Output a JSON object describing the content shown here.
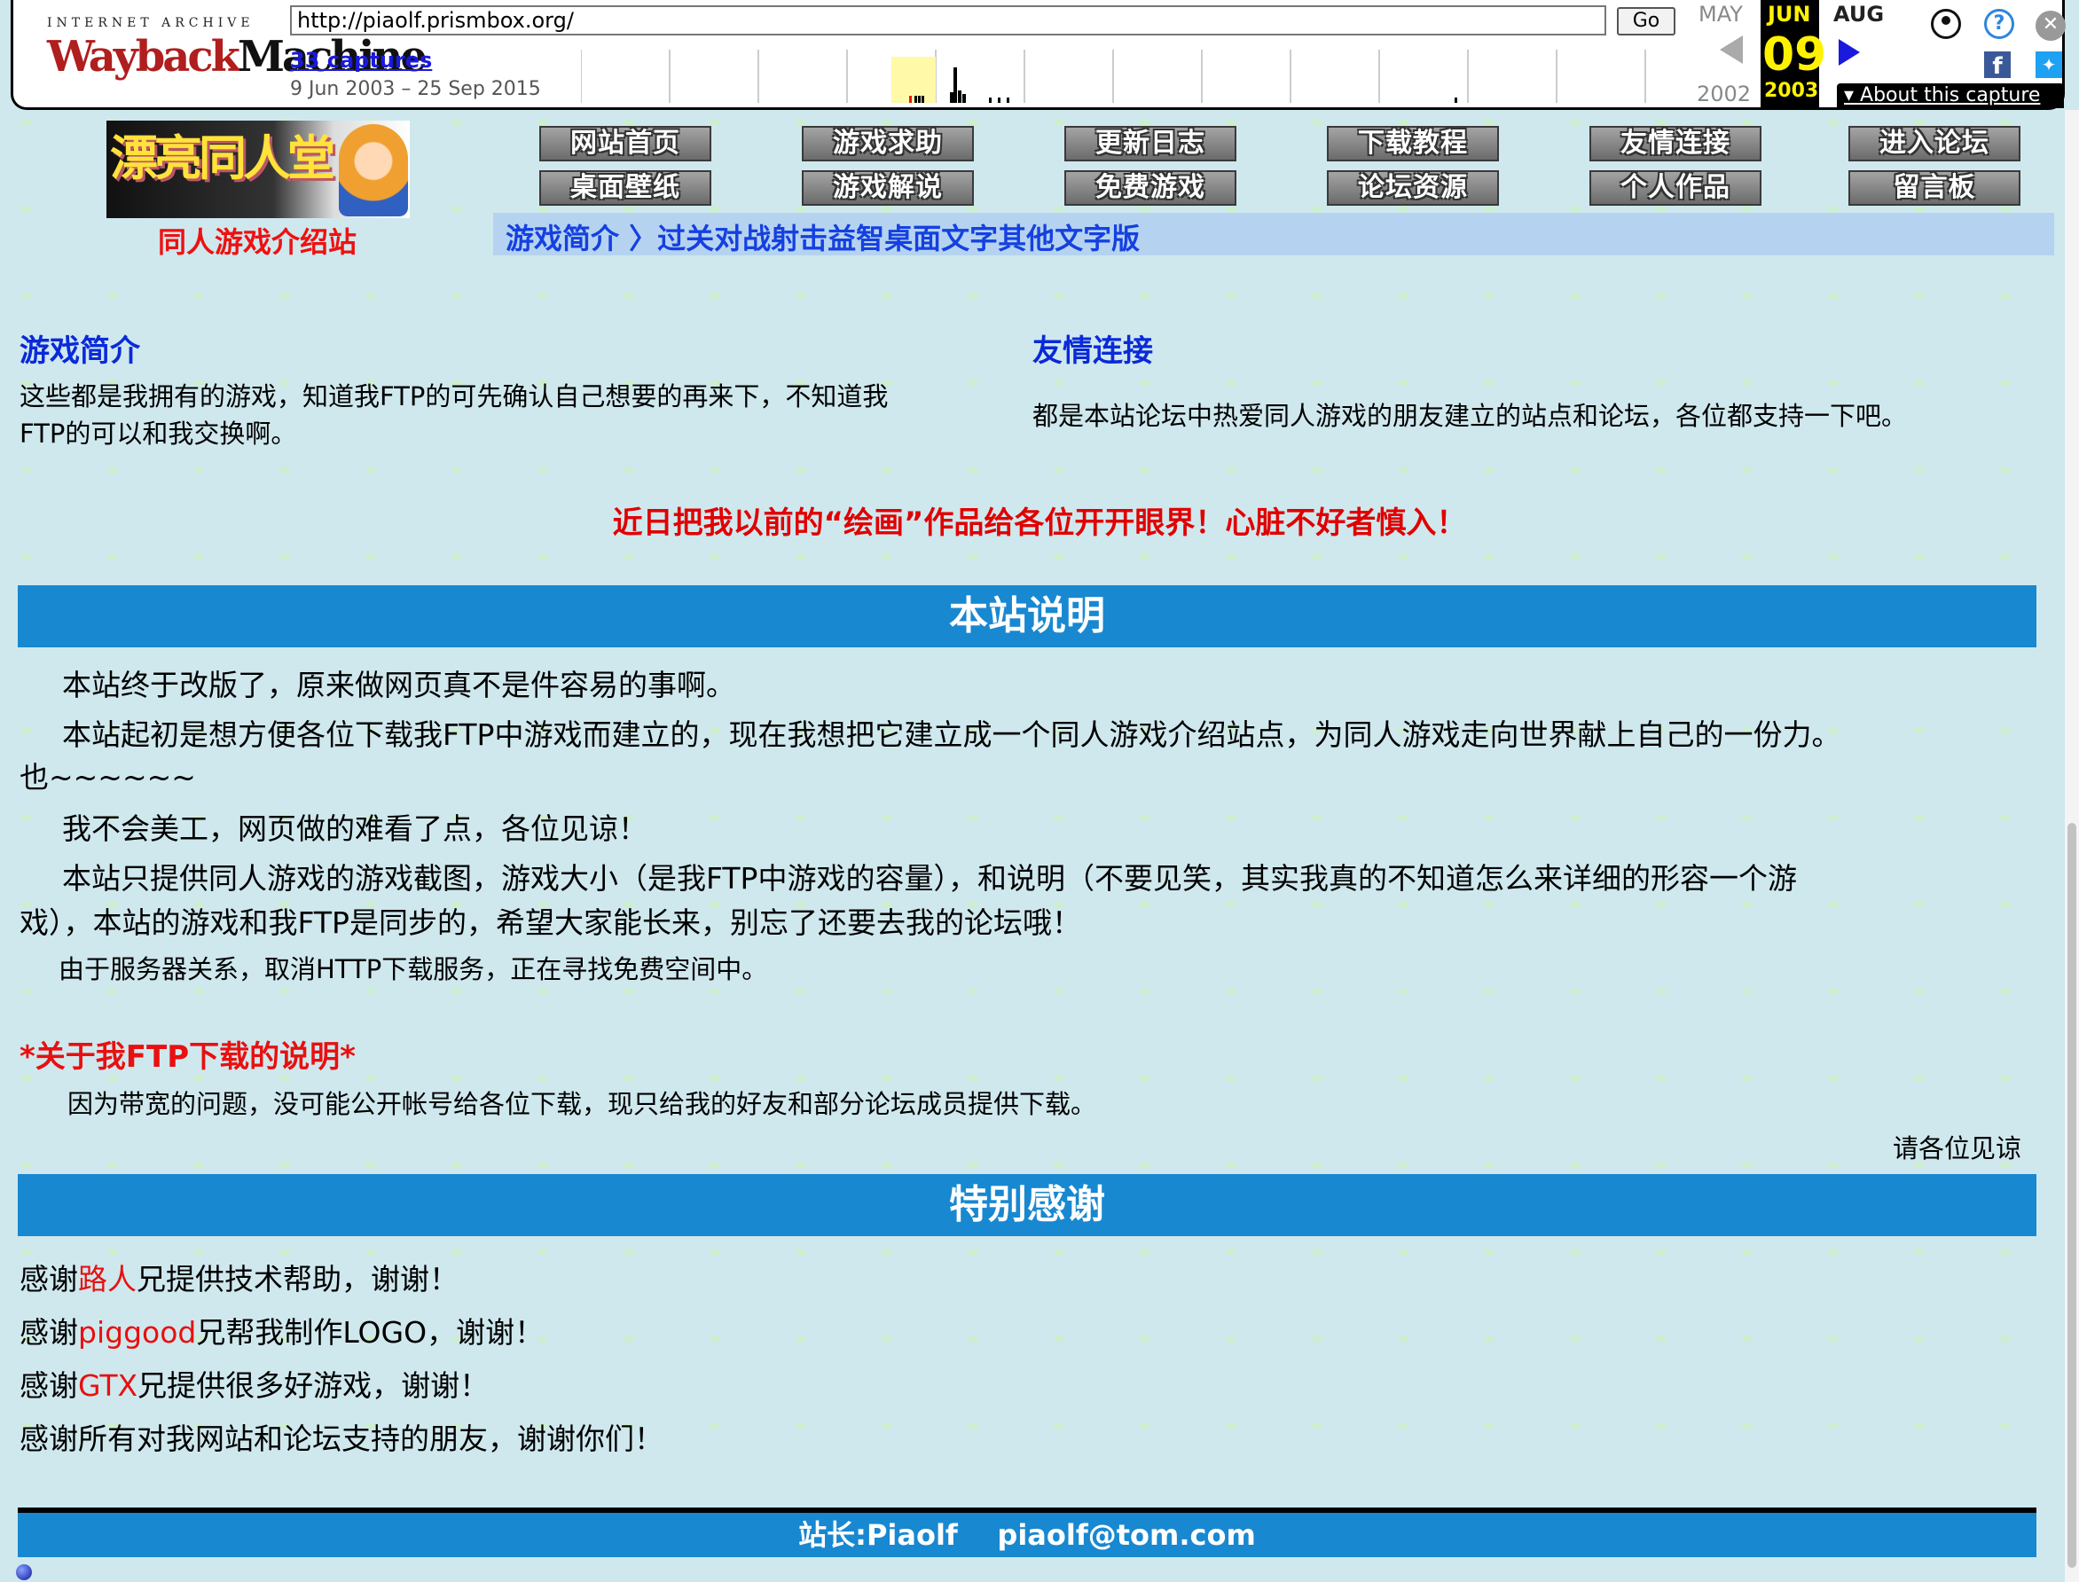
{
  "wayback": {
    "logo_top": "INTERNET ARCHIVE",
    "logo_main_red": "Wayback",
    "logo_main_black": "Machine",
    "url": "http://piaolf.prismbox.org/",
    "go_label": "Go",
    "captures": "33 captures",
    "date_range": "9 Jun 2003 – 25 Sep 2015",
    "prev_month": "MAY",
    "current_month": "JUN",
    "next_month": "AUG",
    "day": "09",
    "prev_year": "2002",
    "current_year": "2003",
    "about": "About this capture",
    "icons": [
      "user-icon",
      "help-icon",
      "close-icon",
      "facebook-icon",
      "twitter-icon"
    ],
    "accent_color": "#fff200"
  },
  "site": {
    "logo_text": "漂亮同人堂",
    "subtitle": "同人游戏介绍站",
    "nav": [
      [
        "网站首页",
        "桌面壁纸"
      ],
      [
        "游戏求助",
        "游戏解说"
      ],
      [
        "更新日志",
        "免费游戏"
      ],
      [
        "下载教程",
        "论坛资源"
      ],
      [
        "友情连接",
        "个人作品"
      ],
      [
        "进入论坛",
        "留言板"
      ]
    ],
    "category_bar": "游戏简介 〉过关对战射击益智桌面文字其他文字版"
  },
  "intro": {
    "games_title": "游戏简介",
    "games_text_1": "这些都是我拥有的游戏，知道我FTP的可先确认自己想要的再来下，不知道我",
    "games_text_2": "FTP的可以和我交换啊。",
    "links_title": "友情连接",
    "links_text": "都是本站论坛中热爱同人游戏的朋友建立的站点和论坛，各位都支持一下吧。"
  },
  "promo": "近日把我以前的“绘画”作品给各位开开眼界！心脏不好者慎入！",
  "about": {
    "title": "本站说明",
    "p1": "本站终于改版了，原来做网页真不是件容易的事啊。",
    "p2a": "本站起初是想方便各位下载我FTP中游戏而建立的，现在我想把它建立成一个同人游戏介绍站点，为同人游戏走向世界献上自己的一份力。",
    "p2b": "也~~~~~~",
    "p3": "我不会美工，网页做的难看了点，各位见谅！",
    "p4a": "本站只提供同人游戏的游戏截图，游戏大小（是我FTP中游戏的容量），和说明（不要见笑，其实我真的不知道怎么来详细的形容一个游",
    "p4b": "戏），本站的游戏和我FTP是同步的，希望大家能长来，别忘了还要去我的论坛哦！",
    "p5": "由于服务器关系，取消HTTP下载服务，正在寻找免费空间中。",
    "ftp_title": "*关于我FTP下载的说明*",
    "ftp_text": "因为带宽的问题，没可能公开帐号给各位下载，现只给我的好友和部分论坛成员提供下载。",
    "ftp_sign": "请各位见谅"
  },
  "thanks": {
    "title": "特别感谢",
    "lines": [
      {
        "pre": "感谢",
        "name": "路人",
        "post": "兄提供技术帮助，谢谢！"
      },
      {
        "pre": "感谢",
        "name": "piggood",
        "post": "兄帮我制作LOGO，谢谢！"
      },
      {
        "pre": "感谢",
        "name": "GTX",
        "post": "兄提供很多好游戏，谢谢！"
      },
      {
        "pre": "感谢所有对我网站和论坛支持的朋友，谢谢你们！",
        "name": "",
        "post": ""
      }
    ]
  },
  "footer": "站长:Piaolf    piaolf@tom.com",
  "colors": {
    "section_bar": "#1888d0",
    "heading_blue": "#0a2ad8",
    "highlight_red": "#e81010"
  }
}
